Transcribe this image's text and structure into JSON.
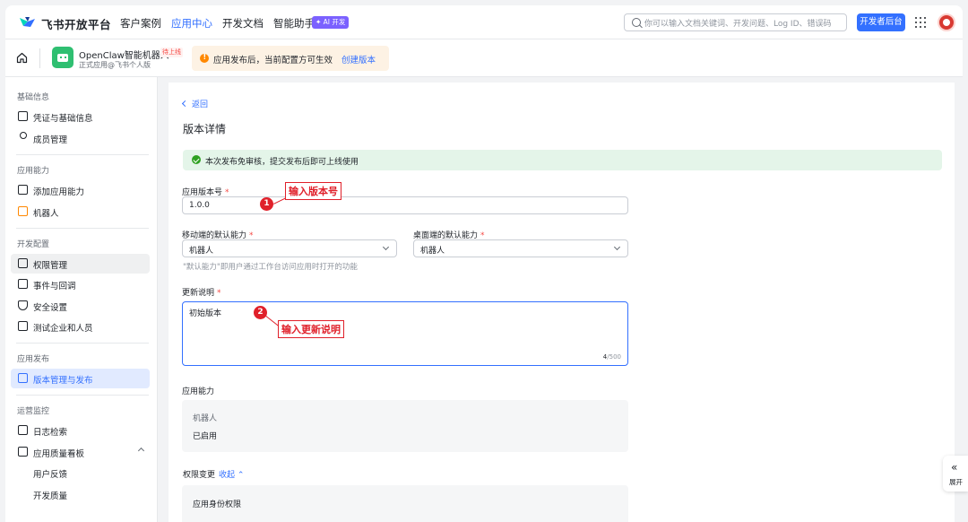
{
  "header": {
    "brand": "飞书开放平台",
    "nav": [
      "客户案例",
      "应用中心",
      "开发文档",
      "智能助手"
    ],
    "active_nav": "应用中心",
    "ai_badge": "✦ AI 开发",
    "search_placeholder": "你可以输入文档关键词、开发问题、Log ID、错误码",
    "dev_console_button": "开发者后台",
    "brand_color": "#3370ff"
  },
  "app": {
    "name": "OpenClaw智能机器人",
    "status_tag": "待上线",
    "subtitle": "正式应用@飞书个人版",
    "notice_text": "应用发布后，当前配置方可生效",
    "notice_link": "创建版本"
  },
  "sidebar": {
    "sections": [
      {
        "title": "基础信息",
        "items": [
          {
            "label": "凭证与基础信息",
            "icon": "credential-icon"
          },
          {
            "label": "成员管理",
            "icon": "person-icon"
          }
        ]
      },
      {
        "title": "应用能力",
        "items": [
          {
            "label": "添加应用能力",
            "icon": "grid-add-icon"
          },
          {
            "label": "机器人",
            "icon": "robot-icon"
          }
        ]
      },
      {
        "title": "开发配置",
        "items": [
          {
            "label": "权限管理",
            "icon": "permission-icon"
          },
          {
            "label": "事件与回调",
            "icon": "event-icon"
          },
          {
            "label": "安全设置",
            "icon": "shield-icon"
          },
          {
            "label": "测试企业和人员",
            "icon": "test-icon"
          }
        ]
      },
      {
        "title": "应用发布",
        "items": [
          {
            "label": "版本管理与发布",
            "icon": "publish-icon"
          }
        ]
      },
      {
        "title": "运营监控",
        "items": [
          {
            "label": "日志检索",
            "icon": "log-icon"
          },
          {
            "label": "应用质量看板",
            "icon": "chart-icon"
          },
          {
            "label": "用户反馈",
            "icon": ""
          },
          {
            "label": "开发质量",
            "icon": ""
          }
        ]
      }
    ],
    "selected": "版本管理与发布"
  },
  "main": {
    "back": "返回",
    "title": "版本详情",
    "success_msg": "本次发布免审核，提交发布后即可上线使用",
    "version_label": "应用版本号",
    "version_value": "1.0.0",
    "mobile_label": "移动端的默认能力",
    "mobile_value": "机器人",
    "desktop_label": "桌面端的默认能力",
    "desktop_value": "机器人",
    "default_hint": "\"默认能力\"即用户通过工作台访问应用时打开的功能",
    "desc_label": "更新说明",
    "desc_value": "初始版本",
    "desc_count": "4",
    "desc_max": "/500",
    "capability_label": "应用能力",
    "capability_name": "机器人",
    "capability_status": "已启用",
    "perm_label": "权限变更",
    "perm_toggle": "收起 ⌃",
    "perm_box_title": "应用身份权限",
    "required_mark": "*"
  },
  "annotations": {
    "one_num": "1",
    "one_text": "输入版本号",
    "two_num": "2",
    "two_text": "输入更新说明",
    "color": "#e0202a"
  },
  "expand": {
    "icon": "«",
    "label": "展开"
  }
}
